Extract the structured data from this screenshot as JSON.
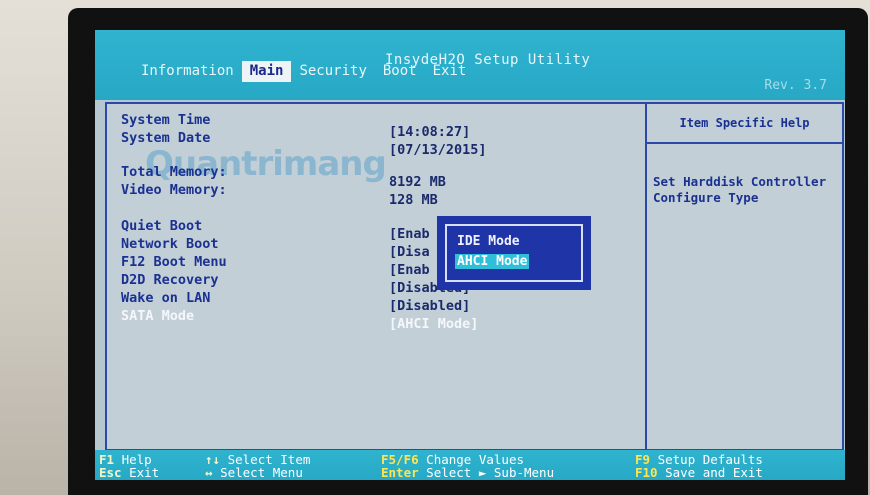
{
  "header": {
    "app_title": "InsydeH2O Setup Utility",
    "revision": "Rev. 3.7",
    "tabs": [
      "Information",
      "Main",
      "Security",
      "Boot",
      "Exit"
    ],
    "active_tab": "Main"
  },
  "watermark": "Quantrimang",
  "settings": [
    {
      "label": "System Time",
      "value": "[14:08:27]"
    },
    {
      "label": "System Date",
      "value": "[07/13/2015]"
    },
    {
      "label": "Total Memory:",
      "value": "8192 MB"
    },
    {
      "label": "Video Memory:",
      "value": "128 MB"
    },
    {
      "label": "Quiet Boot",
      "value": "[Enab"
    },
    {
      "label": "Network Boot",
      "value": "[Disa"
    },
    {
      "label": "F12 Boot Menu",
      "value": "[Enab"
    },
    {
      "label": "D2D Recovery",
      "value": "[Disabled]"
    },
    {
      "label": "Wake on LAN",
      "value": "[Disabled]"
    },
    {
      "label": "SATA Mode",
      "value": "[AHCI Mode]"
    }
  ],
  "help": {
    "title": "Item Specific Help",
    "text": "Set Harddisk Controller Configure Type"
  },
  "popup": {
    "options": [
      "IDE Mode",
      "AHCI Mode"
    ],
    "selected": "AHCI Mode"
  },
  "footer": {
    "keys": [
      {
        "key": "F1",
        "desc": "Help"
      },
      {
        "key": "Esc",
        "desc": "Exit"
      },
      {
        "key": "↑↓",
        "desc": "Select Item"
      },
      {
        "key": "↔",
        "desc": "Select Menu"
      },
      {
        "key": "F5/F6",
        "desc": "Change Values"
      },
      {
        "key": "Enter",
        "desc": "Select ► Sub-Menu"
      },
      {
        "key": "F9",
        "desc": "Setup Defaults"
      },
      {
        "key": "F10",
        "desc": "Save and Exit"
      }
    ]
  },
  "colors": {
    "bar": "#2fb3cf",
    "panel": "#c3cfd6",
    "text": "#1a3192",
    "popup": "#1f34a6",
    "highlight": "#2fbfd8"
  }
}
